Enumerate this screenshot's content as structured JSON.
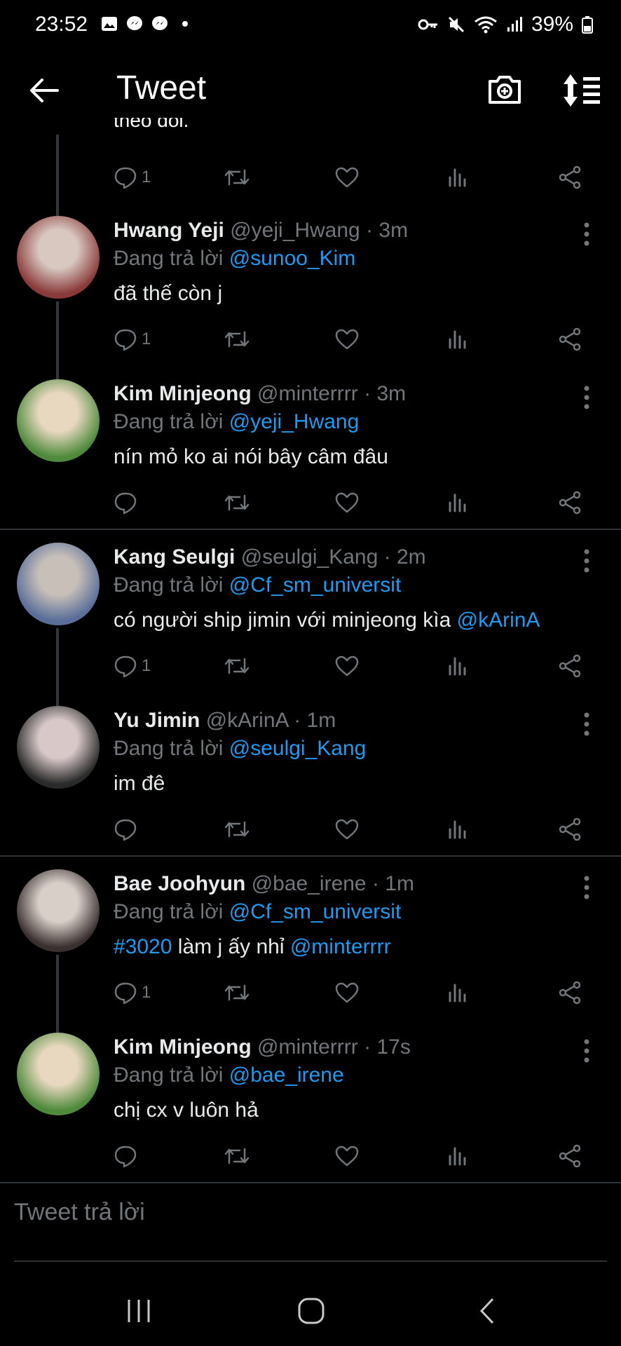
{
  "status_bar": {
    "time": "23:52",
    "battery": "39%"
  },
  "header": {
    "title": "Tweet"
  },
  "partial_tweet": {
    "text": "theo dõi.",
    "reply_count": "1"
  },
  "tweets": [
    {
      "name": "Hwang Yeji",
      "handle": "@yeji_Hwang",
      "time": "· 3m",
      "replying_prefix": "Đang trả lời",
      "replying_to": "@sunoo_Kim",
      "text": "đã thế còn j",
      "reply_count": "1",
      "avatar_colors": [
        "#8a3a3a",
        "#d8c8c0"
      ]
    },
    {
      "name": "Kim Minjeong",
      "handle": "@minterrrr",
      "time": "· 3m",
      "replying_prefix": "Đang trả lời",
      "replying_to": "@yeji_Hwang",
      "text": "nín mỏ ko ai nói bây câm đâu",
      "reply_count": "",
      "avatar_colors": [
        "#4e8a3a",
        "#e8d8c0"
      ]
    },
    {
      "name": "Kang Seulgi",
      "handle": "@seulgi_Kang",
      "time": "· 2m",
      "replying_prefix": "Đang trả lời",
      "replying_to": "@Cf_sm_universit",
      "text": "có người ship jimin với minjeong kìa ",
      "text_mention": "@kArinA",
      "reply_count": "1",
      "avatar_colors": [
        "#5a6e9a",
        "#c8c0b8"
      ]
    },
    {
      "name": "Yu Jimin",
      "handle": "@kArinA",
      "time": "· 1m",
      "replying_prefix": "Đang trả lời",
      "replying_to": "@seulgi_Kang",
      "text": "im đê",
      "reply_count": "",
      "avatar_colors": [
        "#2a2a2a",
        "#d8c8c8"
      ]
    },
    {
      "name": "Bae Joohyun",
      "handle": "@bae_irene",
      "time": "· 1m",
      "replying_prefix": "Đang trả lời",
      "replying_to": "@Cf_sm_universit",
      "text_hashtag": "#3020",
      "text": " làm j ấy nhỉ ",
      "text_mention": "@minterrrr",
      "reply_count": "1",
      "avatar_colors": [
        "#3a3030",
        "#d8d0c8"
      ]
    },
    {
      "name": "Kim Minjeong",
      "handle": "@minterrrr",
      "time": "· 17s",
      "replying_prefix": "Đang trả lời",
      "replying_to": "@bae_irene",
      "text": "chị cx v luôn hả",
      "reply_count": "",
      "avatar_colors": [
        "#4e8a3a",
        "#e8d8c0"
      ]
    }
  ],
  "reply_input": {
    "placeholder": "Tweet trả lời"
  },
  "icons": {
    "back": "arrow-left-icon",
    "camera": "camera-plus-icon",
    "sort": "sort-icon",
    "reply": "comment-icon",
    "retweet": "retweet-icon",
    "like": "heart-icon",
    "views": "bar-chart-icon",
    "share": "share-icon",
    "more": "more-vertical-icon"
  },
  "colors": {
    "background": "#000000",
    "accent": "#1d9bf0",
    "muted": "#71767b",
    "divider": "#2f3336"
  }
}
